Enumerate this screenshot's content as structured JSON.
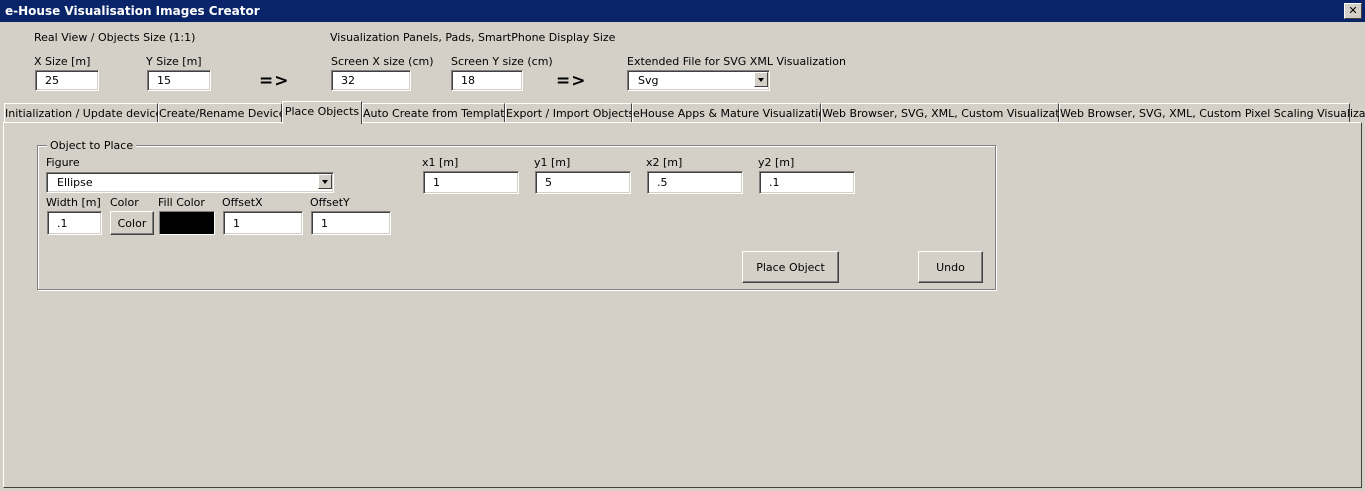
{
  "window": {
    "title": "e-House Visualisation Images Creator",
    "close_label": "✕"
  },
  "top": {
    "real_view_label": "Real View / Objects Size (1:1)",
    "x_size_label": "X Size [m]",
    "x_size_value": "25",
    "y_size_label": "Y Size [m]",
    "y_size_value": "15",
    "arrow1": "=>",
    "panels_label": "Visualization Panels, Pads, SmartPhone Display Size",
    "screen_x_label": "Screen X size (cm)",
    "screen_x_value": "32",
    "screen_y_label": "Screen Y size (cm)",
    "screen_y_value": "18",
    "arrow2": "=>",
    "ext_file_label": "Extended File for SVG XML Visualization",
    "ext_file_value": "Svg"
  },
  "tabs": [
    {
      "label": "Initialization / Update devices"
    },
    {
      "label": "Create/Rename Device"
    },
    {
      "label": "Place Objects"
    },
    {
      "label": "Auto Create from Template"
    },
    {
      "label": "Export / Import Objects"
    },
    {
      "label": "eHouse Apps & Mature Visualizations"
    },
    {
      "label": "Web Browser, SVG, XML, Custom Visualizations"
    },
    {
      "label": "Web Browser, SVG, XML, Custom Pixel Scaling Visualization"
    }
  ],
  "place": {
    "group_title": "Object to Place",
    "figure_label": "Figure",
    "figure_value": "Ellipse",
    "x1_label": "x1 [m]",
    "x1_value": "1",
    "y1_label": "y1 [m]",
    "y1_value": "5",
    "x2_label": "x2 [m]",
    "x2_value": ".5",
    "y2_label": "y2 [m]",
    "y2_value": ".1",
    "width_label": "Width [m]",
    "width_value": ".1",
    "color_label": "Color",
    "color_button": "Color",
    "fill_color_label": "Fill Color",
    "fill_color_hex": "#000000",
    "offsetx_label": "OffsetX",
    "offsetx_value": "1",
    "offsety_label": "OffsetY",
    "offsety_value": "1",
    "place_button": "Place Object",
    "undo_button": "Undo"
  }
}
